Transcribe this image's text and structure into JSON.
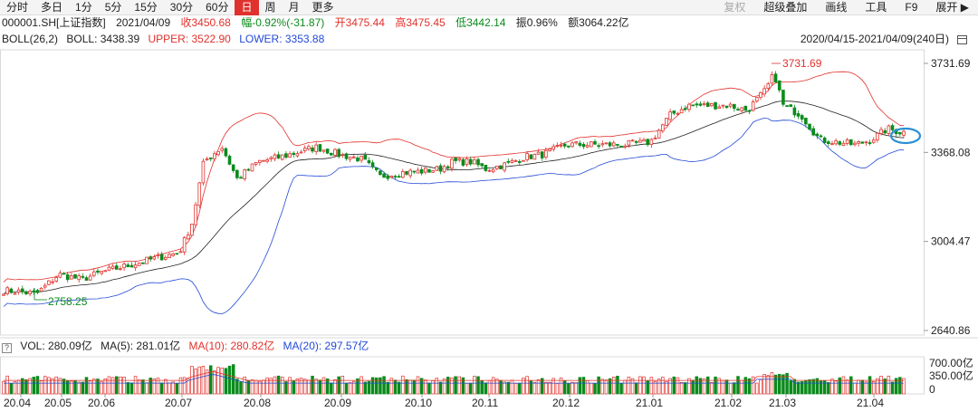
{
  "toolbar": {
    "tabs": [
      {
        "label": "分时",
        "active": false
      },
      {
        "label": "多日",
        "active": false
      },
      {
        "label": "1分",
        "active": false
      },
      {
        "label": "5分",
        "active": false
      },
      {
        "label": "15分",
        "active": false
      },
      {
        "label": "30分",
        "active": false
      },
      {
        "label": "60分",
        "active": false
      },
      {
        "label": "日",
        "active": true
      },
      {
        "label": "周",
        "active": false
      },
      {
        "label": "月",
        "active": false
      },
      {
        "label": "更多",
        "active": false
      }
    ],
    "right": [
      "复权",
      "超级叠加",
      "画线",
      "工具",
      "F9",
      "展开"
    ]
  },
  "info": {
    "code": "000001.SH[上证指数]",
    "date": "2021/04/09",
    "close": "收3450.68",
    "change": "幅-0.92%(-31.87)",
    "open": "开3475.44",
    "high": "高3475.45",
    "low": "低3442.14",
    "amplitude": "振0.96%",
    "amount": "额3064.22亿"
  },
  "boll": {
    "label": "BOLL(26,2)",
    "mid": "BOLL: 3438.39",
    "upper": "UPPER: 3522.90",
    "lower": "LOWER: 3353.88",
    "range": "2020/04/15-2021/04/09(240日)"
  },
  "volume": {
    "help": "?",
    "vol": "VOL: 280.09亿",
    "ma5": "MA(5): 281.01亿",
    "ma10": "MA(10): 280.82亿",
    "ma20": "MA(20): 297.57亿",
    "axis": [
      "700.00亿",
      "350.00亿",
      "0"
    ]
  },
  "chart_data": {
    "type": "candlestick",
    "price_axis_labels": [
      "3731.69",
      "3368.08",
      "3004.47",
      "2640.86"
    ],
    "ylim": [
      2640.86,
      3731.69
    ],
    "annotations": {
      "high": "3731.69",
      "low": "2758.25"
    },
    "months": [
      "20.04",
      "20.05",
      "20.06",
      "20.07",
      "20.08",
      "20.09",
      "20.10",
      "20.11",
      "20.12",
      "21.01",
      "21.02",
      "21.03",
      "21.04"
    ],
    "period_days": 240,
    "close_series": [
      [
        "20.04",
        2800
      ],
      [
        "20.05",
        2860
      ],
      [
        "20.06",
        2920
      ],
      [
        "20.07",
        3320
      ],
      [
        "20.08",
        3380
      ],
      [
        "20.09",
        3280
      ],
      [
        "20.10",
        3290
      ],
      [
        "20.11",
        3400
      ],
      [
        "20.12",
        3420
      ],
      [
        "21.01",
        3560
      ],
      [
        "21.02",
        3640
      ],
      [
        "21.03",
        3400
      ],
      [
        "21.04",
        3450.68
      ]
    ],
    "colors": {
      "up": "#e0312c",
      "down": "#0b8b1c",
      "mid": "#222222",
      "upper": "#e0312c",
      "lower": "#2349d6",
      "ma20": "#2349d6",
      "marker": "#2b8fd6"
    }
  }
}
